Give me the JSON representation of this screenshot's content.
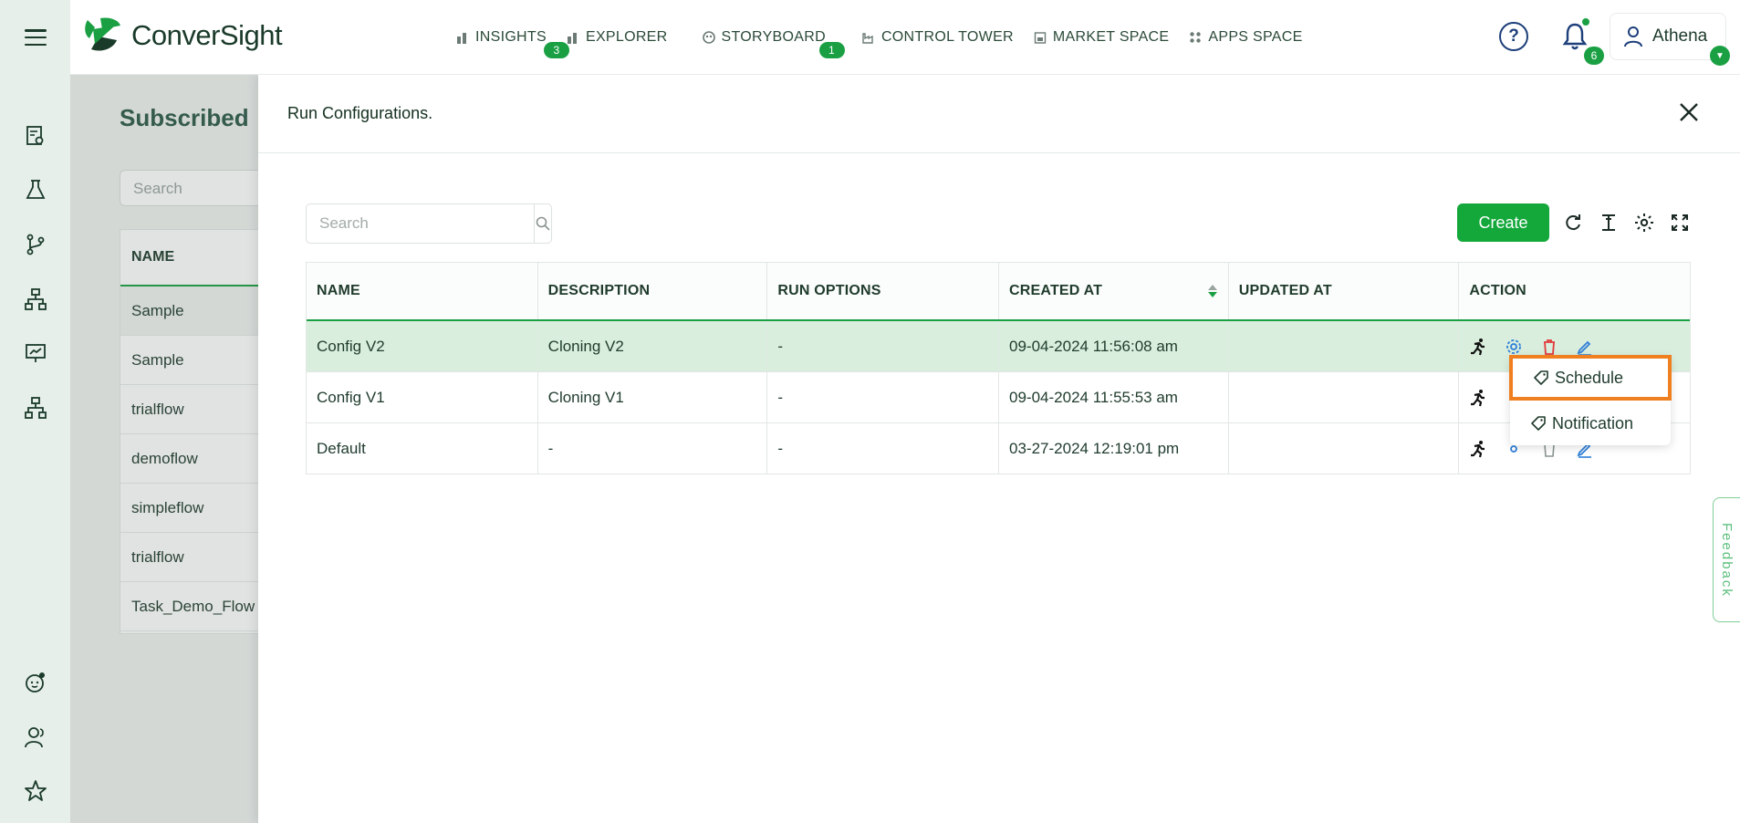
{
  "app": {
    "brand": "ConverSight"
  },
  "nav": [
    {
      "label": "INSIGHTS",
      "badge": "3",
      "icon": "bar-chart-icon"
    },
    {
      "label": "EXPLORER",
      "badge": "",
      "icon": "bar-chart-icon"
    },
    {
      "label": "STORYBOARD",
      "badge": "1",
      "icon": "palette-icon"
    },
    {
      "label": "CONTROL TOWER",
      "badge": "",
      "icon": "factory-icon"
    },
    {
      "label": "MARKET SPACE",
      "badge": "",
      "icon": "store-icon"
    },
    {
      "label": "APPS SPACE",
      "badge": "",
      "icon": "grid-icon"
    }
  ],
  "header": {
    "notifications_count": "6",
    "user_name": "Athena"
  },
  "background_page": {
    "title": "Subscribed",
    "search_placeholder": "Search",
    "column": "NAME",
    "rows": [
      "Sample",
      "Sample",
      "trialflow",
      "demoflow",
      "simpleflow",
      "trialflow",
      "Task_Demo_Flow"
    ]
  },
  "drawer": {
    "title": "Run Configurations.",
    "search_placeholder": "Search",
    "create_label": "Create",
    "columns": [
      "NAME",
      "DESCRIPTION",
      "RUN OPTIONS",
      "CREATED AT",
      "UPDATED AT",
      "ACTION"
    ],
    "rows": [
      {
        "name": "Config V2",
        "description": "Cloning V2",
        "run_options": "-",
        "created_at": "09-04-2024 11:56:08 am",
        "updated_at": ""
      },
      {
        "name": "Config V1",
        "description": "Cloning V1",
        "run_options": "-",
        "created_at": "09-04-2024 11:55:53 am",
        "updated_at": ""
      },
      {
        "name": "Default",
        "description": "-",
        "run_options": "-",
        "created_at": "03-27-2024 12:19:01 pm",
        "updated_at": ""
      }
    ]
  },
  "context_menu": {
    "items": [
      "Schedule",
      "Notification"
    ]
  },
  "feedback_label": "Feedback",
  "colors": {
    "accent": "#14a83b",
    "highlight": "#f07f1f",
    "selected_row": "#d9eedd"
  }
}
